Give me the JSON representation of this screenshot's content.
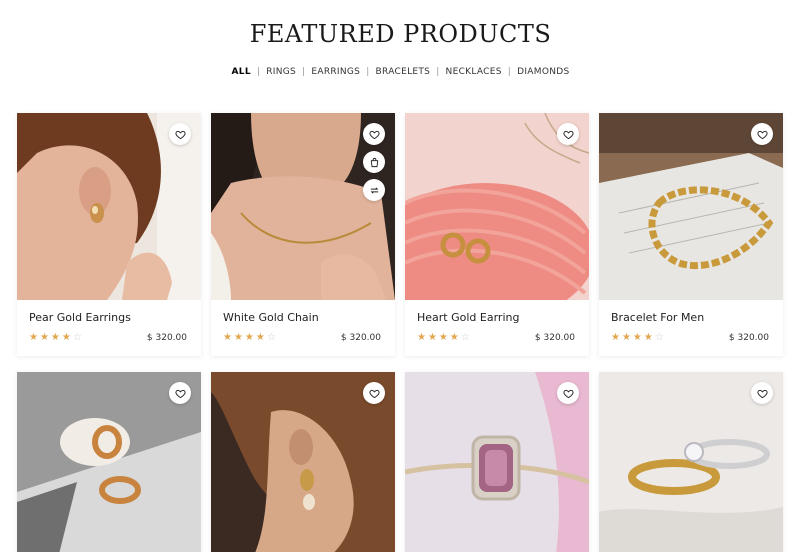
{
  "header": {
    "title": "FEATURED PRODUCTS"
  },
  "filters": [
    "ALL",
    "RINGS",
    "EARRINGS",
    "BRACELETS",
    "NECKLACES",
    "DIAMONDS"
  ],
  "active_filter": "ALL",
  "products": [
    {
      "name": "Pear Gold Earrings",
      "price": "$ 320.00",
      "rating": 4,
      "max_rating": 5
    },
    {
      "name": "White Gold Chain",
      "price": "$ 320.00",
      "rating": 4,
      "max_rating": 5
    },
    {
      "name": "Heart Gold Earring",
      "price": "$ 320.00",
      "rating": 4,
      "max_rating": 5
    },
    {
      "name": "Bracelet For Men",
      "price": "$ 320.00",
      "rating": 4,
      "max_rating": 5
    }
  ],
  "colors": {
    "star": "#e1a851",
    "star_off": "#cccccc"
  },
  "icons": [
    "heart-icon",
    "bag-icon",
    "compare-icon"
  ]
}
